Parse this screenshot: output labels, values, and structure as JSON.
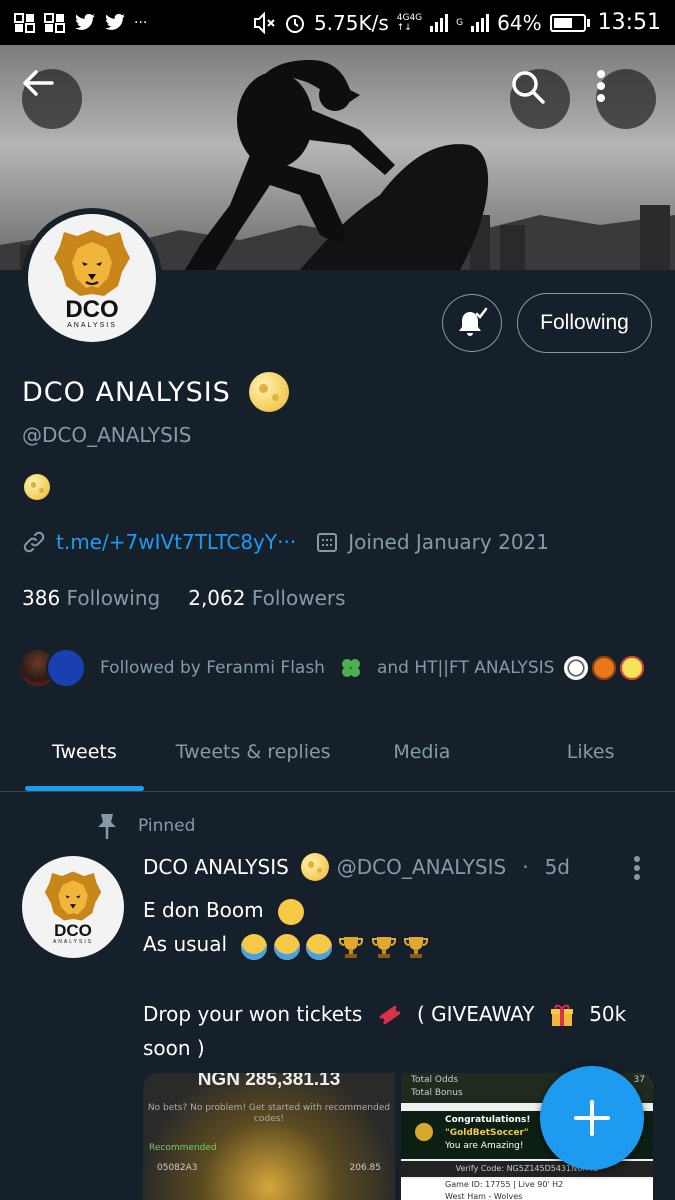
{
  "status_bar": {
    "network_speed": "5.75K/s",
    "net_type_1": "4G",
    "net_type_2": "4G",
    "sim2_label": "G",
    "battery_percent": "64%",
    "battery_level": 0.64,
    "time": "13:51",
    "overflow": "···"
  },
  "banner": {
    "back_icon": "arrow-left-icon",
    "search_icon": "search-icon",
    "more_icon": "more-vertical-icon"
  },
  "profile": {
    "logo_text": "DCO",
    "logo_sub": "ANALYSIS",
    "display_name": "DCO ANALYSIS",
    "handle": "@DCO_ANALYSIS",
    "link": "t.me/+7wIVt7TLTC8yY···",
    "joined": "Joined January 2021",
    "following_count": "386",
    "following_label": "Following",
    "followers_count": "2,062",
    "followers_label": "Followers",
    "followed_by_prefix": "Followed by Feranmi Flash",
    "followed_by_and": "and HT||FT ANALYSIS",
    "following_button": "Following"
  },
  "tabs": [
    {
      "label": "Tweets",
      "active": true
    },
    {
      "label": "Tweets & replies",
      "active": false
    },
    {
      "label": "Media",
      "active": false
    },
    {
      "label": "Likes",
      "active": false
    }
  ],
  "tweet": {
    "pinned_label": "Pinned",
    "name": "DCO ANALYSIS",
    "handle": "@DCO_ANALYSIS",
    "separator": "·",
    "time": "5d",
    "line1": "E don Boom",
    "line2": "As usual",
    "line3_a": "Drop your won tickets",
    "line3_b": "( GIVEAWAY",
    "line3_c": "50k",
    "line4": "soon )",
    "media_1": {
      "amount": "NGN 285,381.13",
      "subtext": "No bets? No problem! Get started with recommended codes!",
      "recommended": "Recommended",
      "code": "05082A3",
      "value": "206.85"
    },
    "media_2": {
      "total_odds": "Total Odds",
      "total_odds_value": "37",
      "total_bonus": "Total Bonus",
      "congrats_1": "Congratulations!",
      "congrats_2": "\"GoldBetSoccer\"",
      "congrats_3": "You are Amazing!",
      "verify": "Verify Code: NG5Z145D5431N6H42",
      "game_id": "Game ID: 17755 | Live 90' H2",
      "match": "West Ham - Wolves"
    }
  },
  "fab": {
    "icon": "plus-icon"
  },
  "colors": {
    "background": "#15202b",
    "accent": "#1d9bf0",
    "muted": "#8899a6",
    "border": "#38444d"
  }
}
